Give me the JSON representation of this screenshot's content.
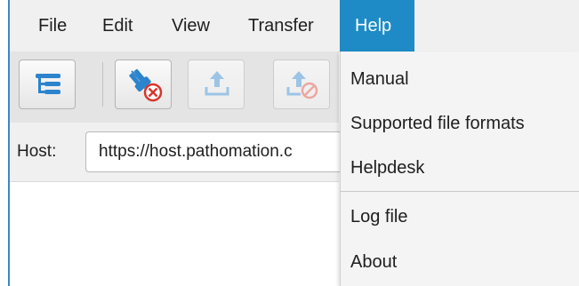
{
  "menubar": {
    "items": [
      {
        "label": "File"
      },
      {
        "label": "Edit"
      },
      {
        "label": "View"
      },
      {
        "label": "Transfer"
      },
      {
        "label": "Help",
        "active": true
      }
    ]
  },
  "toolbar": {
    "buttons": [
      {
        "icon": "tree-list-icon",
        "enabled": true
      },
      {
        "icon": "disconnect-icon",
        "enabled": true
      },
      {
        "icon": "upload-icon",
        "enabled": false
      },
      {
        "icon": "cancel-upload-icon",
        "enabled": false
      }
    ]
  },
  "host": {
    "label": "Host:",
    "value": "https://host.pathomation.c"
  },
  "help_menu": {
    "items": [
      {
        "label": "Manual"
      },
      {
        "label": "Supported file formats"
      },
      {
        "label": "Helpdesk"
      },
      {
        "label": "Log file"
      },
      {
        "label": "About"
      }
    ]
  },
  "colors": {
    "accent": "#1e8bc6",
    "menubar_bg": "#f0f0f0",
    "toolbar_bg": "#e4e4e4",
    "icon_blue": "#2b84cc",
    "icon_red": "#d9352b"
  }
}
